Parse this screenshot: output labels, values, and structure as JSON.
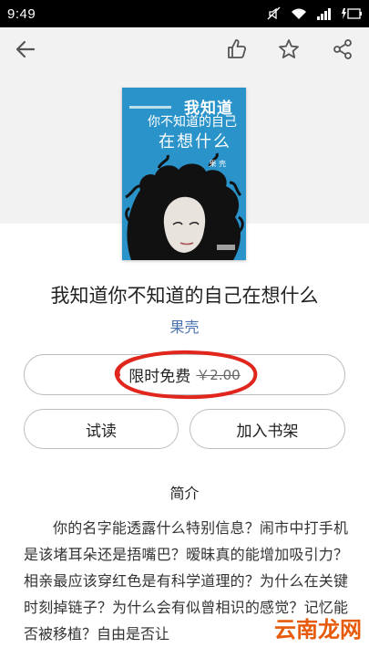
{
  "status_bar": {
    "time": "9:49",
    "icons": [
      "mute-icon",
      "wifi-icon",
      "signal-icon",
      "battery-charging-icon"
    ]
  },
  "toolbar": {
    "icons": [
      "back-arrow-icon",
      "thumbs-up-icon",
      "star-icon",
      "share-icon"
    ]
  },
  "cover": {
    "title_line_1": "我知道",
    "title_line_2": "你不知道的自己",
    "title_line_3": "在想什么",
    "author": "果 壳"
  },
  "book": {
    "title": "我知道你不知道的自己在想什么",
    "author": "果壳"
  },
  "actions": {
    "free_label": "限时免费",
    "original_price": "￥2.00",
    "read_label": "试读",
    "add_shelf_label": "加入书架"
  },
  "intro": {
    "heading": "简介",
    "text": "你的名字能透露什么特别信息？闹市中打手机是该堵耳朵还是捂嘴巴？暧昧真的能增加吸引力？相亲最应该穿红色是有科学道理的？为什么在关键时刻掉链子？为什么会有似曾相识的感觉？记忆能否被移植？自由是否让"
  },
  "watermark": {
    "text": "云南龙网"
  },
  "colors": {
    "status_bar": "#000000",
    "header_band": "#f2f2f2",
    "cover_blue": "#2a93c9",
    "author_link": "#4b73b0",
    "highlight_ellipse": "#e0261d",
    "watermark": "#e65a0a"
  }
}
